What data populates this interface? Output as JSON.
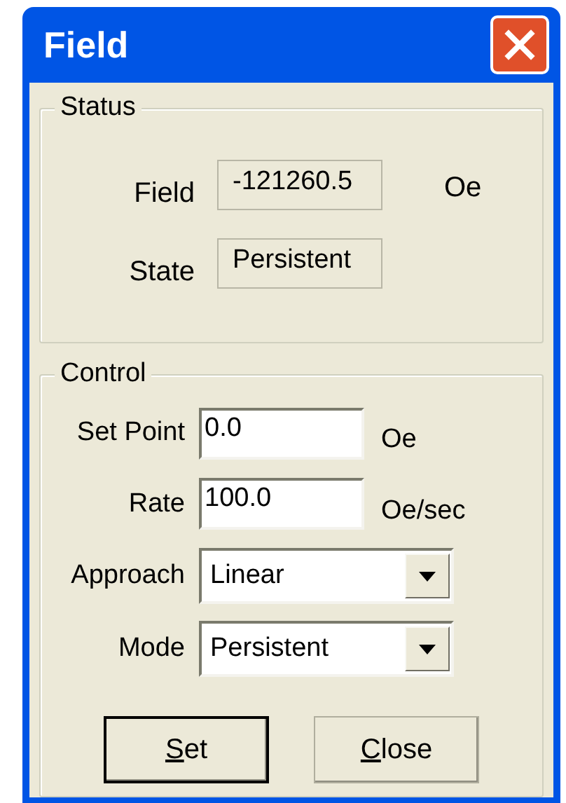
{
  "window": {
    "title": "Field"
  },
  "status": {
    "title": "Status",
    "rows": [
      {
        "label": "Field",
        "value": "-121260.5",
        "unit": "Oe"
      },
      {
        "label": "State",
        "value": "Persistent"
      }
    ]
  },
  "control": {
    "title": "Control",
    "rows": [
      {
        "kind": "input",
        "label": "Set Point",
        "value": "0.0",
        "unit": "Oe"
      },
      {
        "kind": "input",
        "label": "Rate",
        "value": "100.0",
        "unit": "Oe/sec"
      },
      {
        "kind": "select",
        "label": "Approach",
        "value": "Linear"
      },
      {
        "kind": "select",
        "label": "Mode",
        "value": "Persistent"
      }
    ]
  },
  "buttons": [
    {
      "label_parts": [
        {
          "text": "S",
          "underlined": true
        },
        {
          "text": "et",
          "underlined": false
        }
      ],
      "default": true
    },
    {
      "label_parts": [
        {
          "text": "C",
          "underlined": true
        },
        {
          "text": "lose",
          "underlined": false
        }
      ],
      "default": false
    }
  ]
}
